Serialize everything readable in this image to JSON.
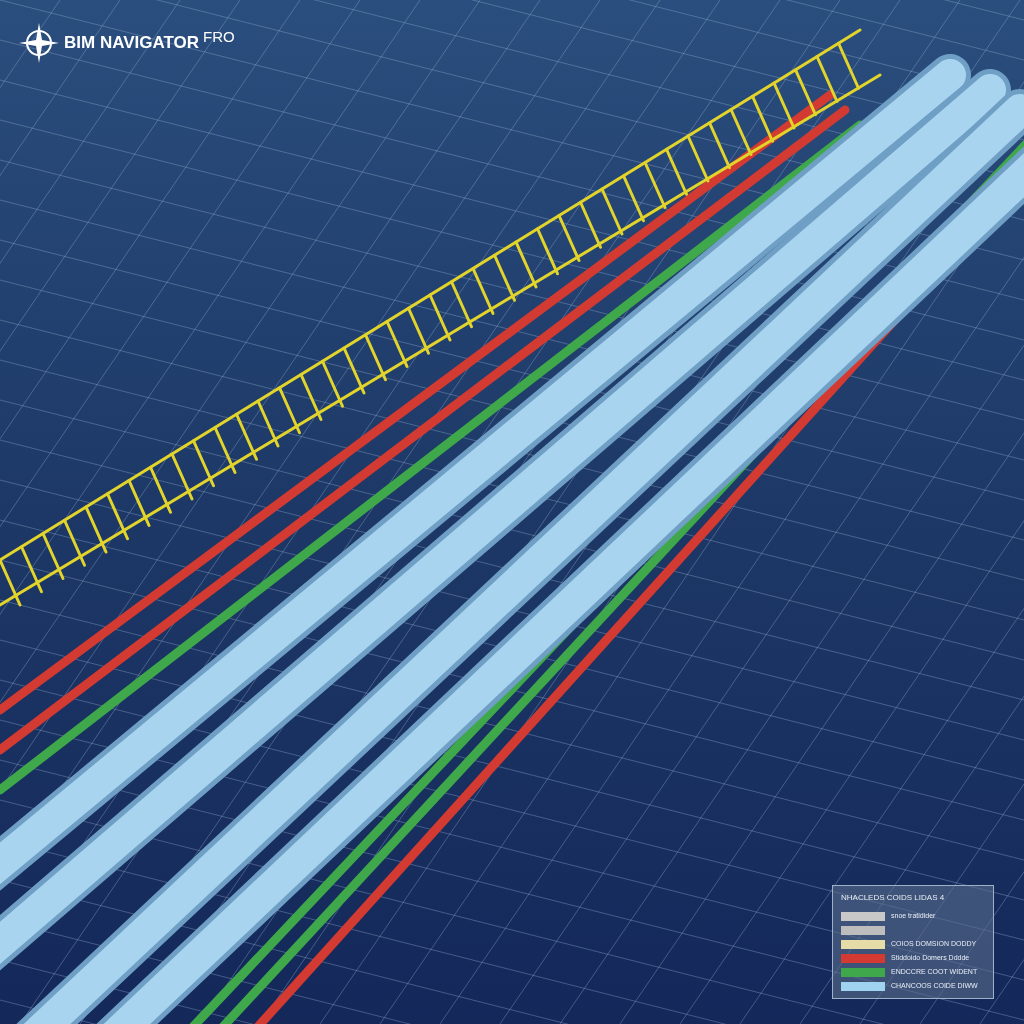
{
  "logo": {
    "name": "BIM NAVIGATOR",
    "edition": "FRO"
  },
  "legend": {
    "title": "NHACLEDS COIDS LIDAS 4",
    "items": [
      {
        "label": "snoe tratidider",
        "color": "#c8c8c8"
      },
      {
        "color": "#bdbdbd"
      },
      {
        "label": "COIOS DOMSION DODDY",
        "color": "#e6dca8"
      },
      {
        "label": "Stiddoido Domers Dddde",
        "color": "#d23a32"
      },
      {
        "label": "ENDCCRE COOT WIDENT",
        "color": "#3ea84a"
      },
      {
        "label": "CHANCOOS COIDE DIWW",
        "color": "#9fd3f0"
      }
    ]
  }
}
